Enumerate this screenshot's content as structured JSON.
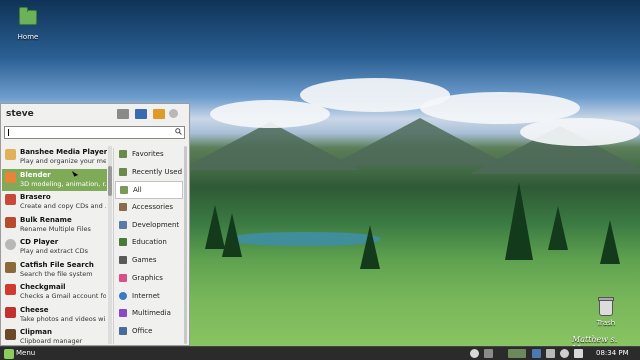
{
  "desktop": {
    "home_label": "Home",
    "trash_label": "Trash",
    "watermark": "Matthew s. Moore"
  },
  "menu": {
    "user": "steve",
    "search_value": "",
    "apps": [
      {
        "name": "Banshee Media Player",
        "desc": "Play and organize your me...",
        "icon": "banshee-icon",
        "color": "#e0b15a"
      },
      {
        "name": "Blender",
        "desc": "3D modeling, animation, r...",
        "icon": "blender-icon",
        "color": "#e8843a",
        "selected": true
      },
      {
        "name": "Brasero",
        "desc": "Create and copy CDs and ...",
        "icon": "brasero-icon",
        "color": "#c9483c"
      },
      {
        "name": "Bulk Rename",
        "desc": "Rename Multiple Files",
        "icon": "bulk-rename-icon",
        "color": "#b84a2e"
      },
      {
        "name": "CD Player",
        "desc": "Play and extract CDs",
        "icon": "cd-player-icon",
        "color": "#b8b8b8"
      },
      {
        "name": "Catfish File Search",
        "desc": "Search the file system",
        "icon": "catfish-icon",
        "color": "#8a6a3a"
      },
      {
        "name": "Checkgmail",
        "desc": "Checks a Gmail account for...",
        "icon": "checkgmail-icon",
        "color": "#d03a2f"
      },
      {
        "name": "Cheese",
        "desc": "Take photos and videos wi...",
        "icon": "cheese-icon",
        "color": "#c23030"
      },
      {
        "name": "Clipman",
        "desc": "Clipboard manager",
        "icon": "clipman-icon",
        "color": "#6b4a2a"
      }
    ],
    "categories": [
      {
        "label": "Favorites",
        "icon": "favorites-icon",
        "color": "#6a8a4a"
      },
      {
        "label": "Recently Used",
        "icon": "recent-icon",
        "color": "#6a8a4a"
      },
      {
        "label": "All",
        "icon": "all-icon",
        "color": "#7a9a5a",
        "active": true
      },
      {
        "label": "Accessories",
        "icon": "accessories-icon",
        "color": "#8a6a4a"
      },
      {
        "label": "Development",
        "icon": "development-icon",
        "color": "#5a7aa8"
      },
      {
        "label": "Education",
        "icon": "education-icon",
        "color": "#4a7a3a"
      },
      {
        "label": "Games",
        "icon": "games-icon",
        "color": "#5a5a5a"
      },
      {
        "label": "Graphics",
        "icon": "graphics-icon",
        "color": "#d8508a"
      },
      {
        "label": "Internet",
        "icon": "internet-icon",
        "color": "#3a7ac8"
      },
      {
        "label": "Multimedia",
        "icon": "multimedia-icon",
        "color": "#8a4ac8"
      },
      {
        "label": "Office",
        "icon": "office-icon",
        "color": "#4a6a9a"
      }
    ]
  },
  "panel": {
    "menu_label": "Menu",
    "clock": "08:34 PM"
  }
}
